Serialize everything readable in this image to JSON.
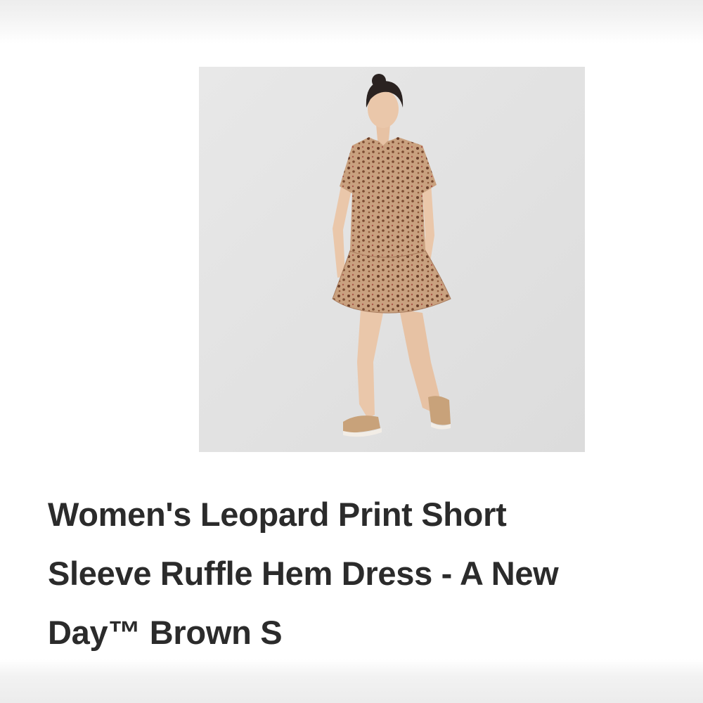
{
  "product": {
    "title_lines": [
      "Women's Leopard Print Short",
      "Sleeve Ruffle Hem Dress - A New",
      "Day™ Brown S"
    ],
    "image": {
      "subject": "model-wearing-leopard-print-dress",
      "background_color": "#e3e3e3",
      "dress_color": "#c9a17f",
      "spot_color": "#6b3f2a"
    }
  }
}
